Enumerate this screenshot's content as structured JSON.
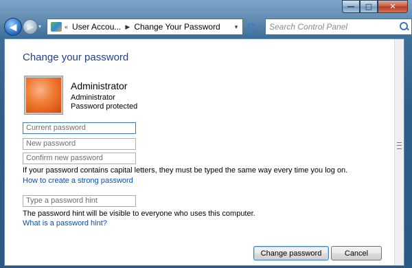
{
  "window": {
    "caption_minimize": "—",
    "caption_maximize": "□",
    "caption_close": "✕"
  },
  "nav": {
    "back_glyph": "◀",
    "forward_glyph": "▶",
    "recent_glyph": "▾",
    "breadcrumb": [
      "User Accou...",
      "Change Your Password"
    ],
    "overflow": "«",
    "separator": "▶",
    "dropdown_glyph": "▾",
    "refresh_glyph": "⟳",
    "search_placeholder": "Search Control Panel"
  },
  "page": {
    "heading": "Change your password",
    "account": {
      "name": "Administrator",
      "type": "Administrator",
      "status": "Password protected"
    },
    "fields": {
      "current": "Current password",
      "new": "New password",
      "confirm": "Confirm new password",
      "hint": "Type a password hint"
    },
    "caps_note": "If your password contains capital letters, they must be typed the same way every time you log on.",
    "strong_link": "How to create a strong password",
    "hint_note": "The password hint will be visible to everyone who uses this computer.",
    "hint_link": "What is a password hint?",
    "buttons": {
      "change": "Change password",
      "cancel": "Cancel"
    }
  }
}
